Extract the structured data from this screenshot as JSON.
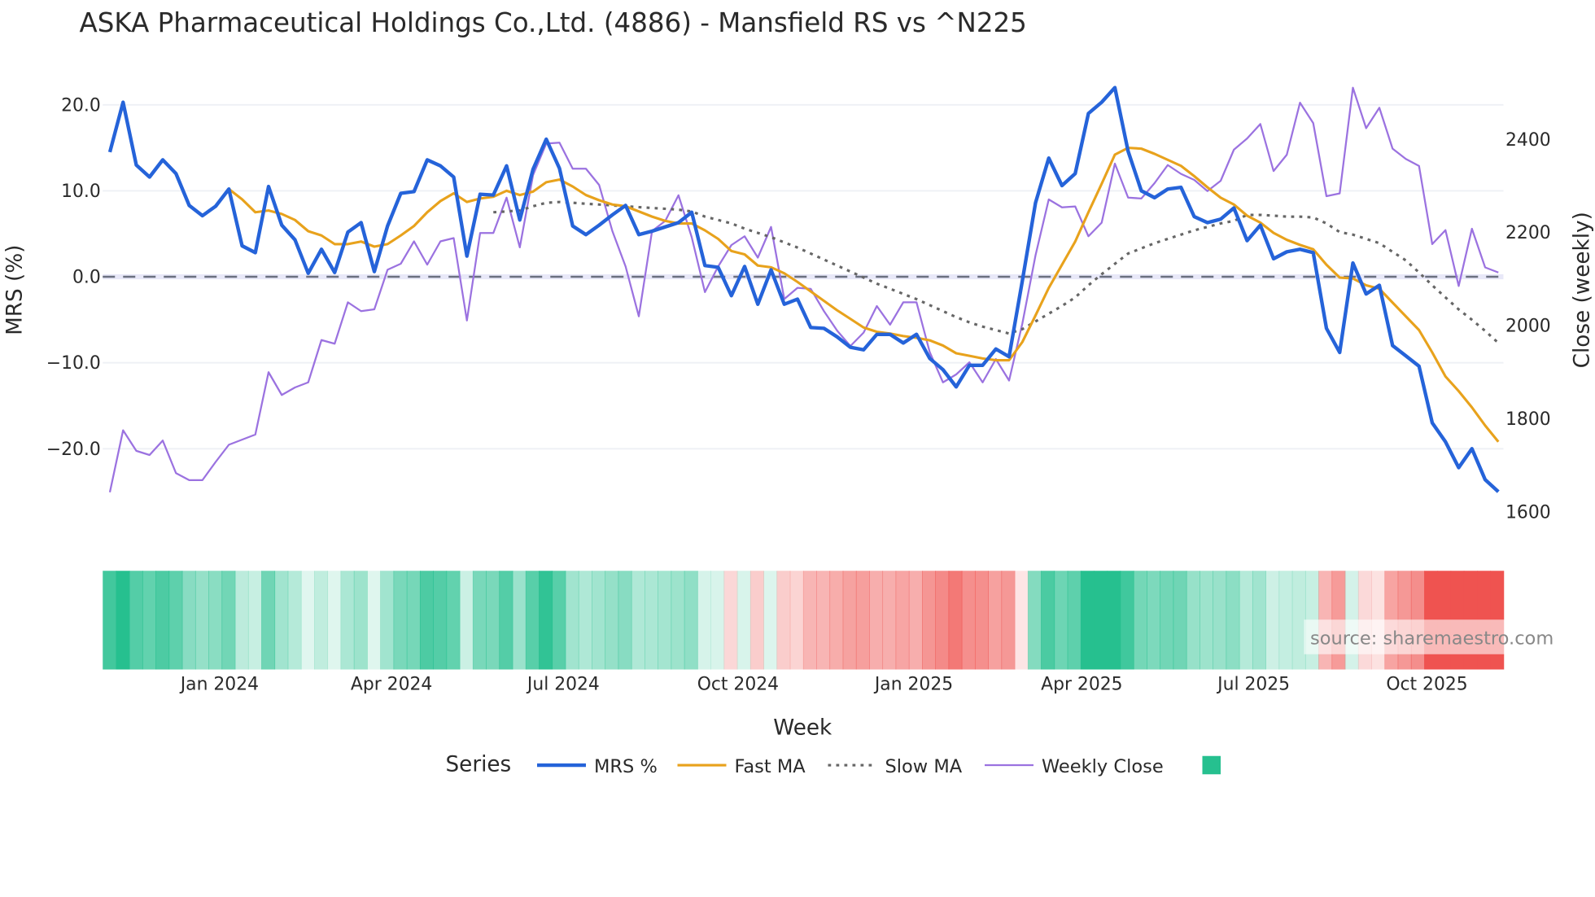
{
  "chart_data": {
    "type": "line",
    "title": "ASKA Pharmaceutical Holdings Co.,Ltd. (4886) - Mansfield RS vs ^N225",
    "xlabel": "Week",
    "ylabel": "MRS (%)",
    "y2label": "Close (weekly)",
    "ylim": [
      -26.5,
      22.5
    ],
    "y_ticks": [
      {
        "value": 20,
        "label": "20.0"
      },
      {
        "value": 10,
        "label": "10.0"
      },
      {
        "value": 0,
        "label": "0.0"
      },
      {
        "value": -10,
        "label": "−10.0"
      },
      {
        "value": -20,
        "label": "−20.0"
      }
    ],
    "y2lim": [
      1590,
      2560
    ],
    "y2_ticks": [
      {
        "value": 1600,
        "label": "1600"
      },
      {
        "value": 1800,
        "label": "1800"
      },
      {
        "value": 2000,
        "label": "2000"
      },
      {
        "value": 2200,
        "label": "2200"
      },
      {
        "value": 2400,
        "label": "2400"
      }
    ],
    "x_range": [
      0,
      105
    ],
    "x_ticks": [
      {
        "week": 8.3,
        "label": "Jan 2024"
      },
      {
        "week": 21.3,
        "label": "Apr 2024"
      },
      {
        "week": 34.3,
        "label": "Jul 2024"
      },
      {
        "week": 47.5,
        "label": "Oct 2024"
      },
      {
        "week": 60.8,
        "label": "Jan 2025"
      },
      {
        "week": 73.5,
        "label": "Apr 2025"
      },
      {
        "week": 86.5,
        "label": "Jul 2025"
      },
      {
        "week": 99.6,
        "label": "Oct 2025"
      }
    ],
    "zero_line": 0,
    "series": [
      {
        "name": "MRS %",
        "color": "#2563d9",
        "axis": "y",
        "values": [
          14.5,
          20.3,
          13,
          11.6,
          13.6,
          12,
          8.3,
          7.1,
          8.2,
          10.2,
          3.6,
          2.8,
          10.5,
          6,
          4.3,
          0.4,
          3.2,
          0.5,
          5.2,
          6.3,
          0.6,
          5.9,
          9.7,
          9.9,
          13.6,
          12.9,
          11.6,
          2.4,
          9.6,
          9.5,
          12.9,
          6.6,
          12.5,
          16,
          12.6,
          5.9,
          4.9,
          6,
          7.2,
          8.3,
          4.9,
          5.3,
          5.8,
          6.3,
          7.5,
          1.3,
          1.1,
          -2.2,
          1.2,
          -3.2,
          0.8,
          -3.2,
          -2.6,
          -5.9,
          -6,
          -7,
          -8.2,
          -8.5,
          -6.7,
          -6.7,
          -7.7,
          -6.7,
          -9.5,
          -10.8,
          -12.8,
          -10.3,
          -10.3,
          -8.4,
          -9.3,
          -0.5,
          8.6,
          13.8,
          10.6,
          12,
          19,
          20.3,
          22,
          14.6,
          10,
          9.2,
          10.2,
          10.4,
          7,
          6.3,
          6.7,
          8,
          4.2,
          6,
          2.1,
          2.9,
          3.2,
          2.8,
          -6,
          -8.8,
          1.6,
          -2,
          -1,
          -8,
          -9.2,
          -10.4,
          -17,
          -19.2,
          -22.2,
          -20,
          -23.6,
          -25
        ]
      },
      {
        "name": "Fast MA",
        "color": "#e8a21c",
        "axis": "y",
        "values": [
          null,
          null,
          null,
          null,
          null,
          null,
          null,
          null,
          null,
          10.2,
          9.0,
          7.5,
          7.7,
          7.3,
          6.6,
          5.3,
          4.8,
          3.8,
          3.8,
          4.1,
          3.5,
          3.8,
          4.8,
          5.9,
          7.5,
          8.8,
          9.7,
          8.7,
          9.1,
          9.3,
          10.0,
          9.5,
          9.9,
          11.0,
          11.3,
          10.5,
          9.5,
          8.9,
          8.4,
          8.2,
          7.6,
          7.0,
          6.5,
          6.2,
          6.2,
          5.4,
          4.4,
          3.0,
          2.6,
          1.3,
          1.1,
          0.4,
          -0.6,
          -1.7,
          -2.8,
          -3.9,
          -4.9,
          -5.9,
          -6.4,
          -6.6,
          -6.9,
          -7.1,
          -7.4,
          -8.0,
          -8.9,
          -9.2,
          -9.5,
          -9.7,
          -9.7,
          -7.6,
          -4.5,
          -1.3,
          1.4,
          4.1,
          7.5,
          10.8,
          14.2,
          15.0,
          14.9,
          14.3,
          13.6,
          12.9,
          11.7,
          10.4,
          9.2,
          8.4,
          7.1,
          6.3,
          5.1,
          4.3,
          3.7,
          3.2,
          1.4,
          -0.1,
          -0.2,
          -1.0,
          -1.4,
          -3.0,
          -4.6,
          -6.2,
          -8.8,
          -11.6,
          -13.3,
          -15.2,
          -17.3,
          -19.2
        ]
      },
      {
        "name": "Slow MA",
        "color": "#666666",
        "axis": "y",
        "dash": "dot",
        "values": [
          null,
          null,
          null,
          null,
          null,
          null,
          null,
          null,
          null,
          null,
          null,
          null,
          null,
          null,
          null,
          null,
          null,
          null,
          null,
          null,
          null,
          null,
          null,
          null,
          null,
          null,
          null,
          null,
          null,
          7.5,
          7.6,
          7.7,
          8.2,
          8.6,
          8.7,
          8.6,
          8.5,
          8.4,
          8.3,
          8.2,
          8.1,
          8.0,
          7.9,
          7.8,
          7.6,
          7.0,
          6.6,
          6.2,
          5.6,
          5.1,
          4.6,
          4.0,
          3.4,
          2.7,
          2.0,
          1.3,
          0.6,
          -0.1,
          -0.8,
          -1.4,
          -2.0,
          -2.6,
          -3.3,
          -4.0,
          -4.7,
          -5.3,
          -5.8,
          -6.2,
          -6.6,
          -6.1,
          -5.2,
          -4.3,
          -3.4,
          -2.4,
          -1.0,
          0.3,
          1.5,
          2.7,
          3.3,
          3.9,
          4.4,
          4.9,
          5.4,
          5.8,
          6.2,
          6.5,
          7.2,
          7.2,
          7.1,
          7.0,
          7.0,
          6.9,
          6.2,
          5.2,
          4.9,
          4.4,
          3.9,
          2.9,
          1.9,
          0.5,
          -1.0,
          -2.4,
          -3.8,
          -5.0,
          -6.3,
          -7.7
        ]
      },
      {
        "name": "Weekly Close",
        "color": "#9b72e0",
        "axis": "y2",
        "values": [
          1642,
          1775,
          1731,
          1722,
          1753,
          1683,
          1668,
          1668,
          1707,
          1744,
          1755,
          1766,
          1900,
          1851,
          1867,
          1878,
          1969,
          1961,
          2050,
          2031,
          2035,
          2120,
          2133,
          2181,
          2131,
          2181,
          2188,
          2011,
          2199,
          2199,
          2275,
          2168,
          2323,
          2391,
          2393,
          2337,
          2337,
          2302,
          2203,
          2127,
          2020,
          2203,
          2225,
          2280,
          2190,
          2072,
          2127,
          2173,
          2192,
          2146,
          2212,
          2057,
          2081,
          2079,
          2031,
          1989,
          1956,
          1985,
          2042,
          2002,
          2050,
          2050,
          1943,
          1878,
          1895,
          1921,
          1878,
          1928,
          1882,
          2004,
          2151,
          2271,
          2254,
          2256,
          2192,
          2221,
          2348,
          2275,
          2273,
          2306,
          2345,
          2326,
          2313,
          2289,
          2311,
          2378,
          2402,
          2433,
          2332,
          2367,
          2479,
          2435,
          2278,
          2284,
          2511,
          2424,
          2468,
          2380,
          2358,
          2343,
          2175,
          2205,
          2085,
          2208,
          2125,
          2114
        ]
      }
    ],
    "heatmap": {
      "source_series": "MRS %",
      "positive_color": "#26c08f",
      "negative_color": "#ef5350"
    },
    "legend": {
      "title": "Series",
      "placement": "bottom",
      "items": [
        "MRS %",
        "Fast MA",
        "Slow MA",
        "Weekly Close",
        ""
      ]
    },
    "watermark": "source: sharemaestro.com"
  }
}
